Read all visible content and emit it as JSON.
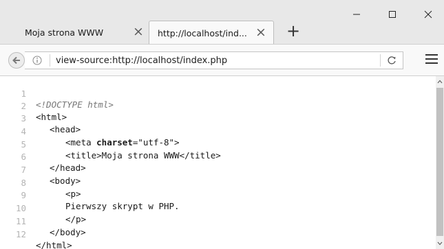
{
  "tabs": [
    {
      "label": "Moja strona WWW"
    },
    {
      "label": "http://localhost/ind..."
    }
  ],
  "address_bar": {
    "url": "view-source:http://localhost/index.php"
  },
  "icons": {
    "back": "back-arrow-icon",
    "info": "info-icon",
    "reload": "reload-icon",
    "menu": "hamburger-menu-icon",
    "new_tab": "plus-icon"
  },
  "source_lines": [
    {
      "num": "1",
      "text": "<!DOCTYPE html>"
    },
    {
      "num": "2",
      "text": "<html>"
    },
    {
      "num": "3",
      "text": "<head>"
    },
    {
      "num": "4",
      "tag_open": "<meta ",
      "attr": "charset",
      "rest": "=\"utf-8\">"
    },
    {
      "num": "5",
      "text": "<title>Moja strona WWW</title>"
    },
    {
      "num": "6",
      "text": "</head>"
    },
    {
      "num": "7",
      "text": "<body>"
    },
    {
      "num": "8",
      "text": "<p>"
    },
    {
      "num": "9",
      "text": "Pierwszy skrypt w PHP."
    },
    {
      "num": "10",
      "text": "</p>"
    },
    {
      "num": "11",
      "text": "</body>"
    },
    {
      "num": "12",
      "text": "</html>"
    }
  ],
  "colors": {
    "tab_bar": "#e8e8e8",
    "line_numbers": "#b3b3b3",
    "doctype": "#777777"
  }
}
